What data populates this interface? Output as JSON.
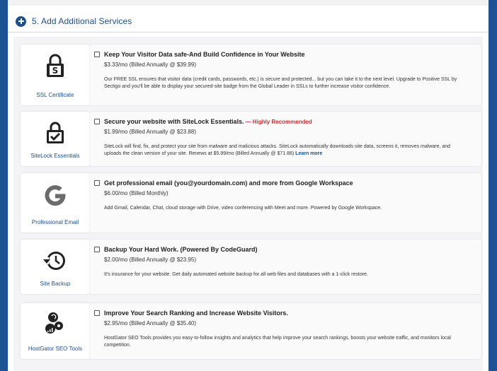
{
  "section": {
    "title": "5. Add Additional Services"
  },
  "services": [
    {
      "card_label": "SSL Certificate",
      "icon": "ssl-lock-icon",
      "title": "Keep Your Visitor Data safe-And Build Confidence in Your Website",
      "highlight": "",
      "price": "$3.33/mo (Billed Annually @ $39.99)",
      "description": "Our FREE SSL ensures that visitor data (credit cards, passwords, etc.) is secure and protected... but you can take it to the next level. Upgrade to Positive SSL by Sectigo and you'll be able to display your secured-site badge from the Global Leader in SSLs to further increase visitor confidence.",
      "link": ""
    },
    {
      "card_label": "SiteLock Essentials",
      "icon": "sitelock-check-icon",
      "title": "Secure your website with SiteLock Essentials.",
      "highlight": "— Highly Recommended",
      "price": "$1.99/mo (Billed Annually @ $23.88)",
      "description": "SiteLock will find, fix, and protect your site from malware and malicious attacks. SiteLock automatically downloads site data, screens it, removes malware, and uploads the clean version of your site. Renews at $5.99/mo (Billed Annually @ $71.88)",
      "link": "Learn more"
    },
    {
      "card_label": "Professional Email",
      "icon": "google-g-icon",
      "title": "Get professional email (you@yourdomain.com) and more from Google Workspace",
      "highlight": "",
      "price": "$6.00/mo (Billed Monthly)",
      "description": "Add Gmail, Calendar, Chat, cloud storage with Drive, video conferencing with Meet and more. Powered by Google Workspace.",
      "link": ""
    },
    {
      "card_label": "Site Backup",
      "icon": "backup-history-icon",
      "title": "Backup Your Hard Work. (Powered By CodeGuard)",
      "highlight": "",
      "price": "$2.00/mo (Billed Annually @ $23.95)",
      "description": "It's insurance for your website. Get daily automated website backup for all web files and databases with a 1-click restore.",
      "link": ""
    },
    {
      "card_label": "HostGator SEO Tools",
      "icon": "seo-tools-icon",
      "title": "Improve Your Search Ranking and Increase Website Visitors.",
      "highlight": "",
      "price": "$2.95/mo (Billed Annually @ $35.40)",
      "description": "HostGator SEO Tools provides you easy-to-follow insights and analytics that help improve your search rankings, boosts your website traffic, and monitors local competition.",
      "link": ""
    }
  ],
  "colors": {
    "brand_blue": "#1b4f8f",
    "highlight_red": "#d32f2f"
  }
}
